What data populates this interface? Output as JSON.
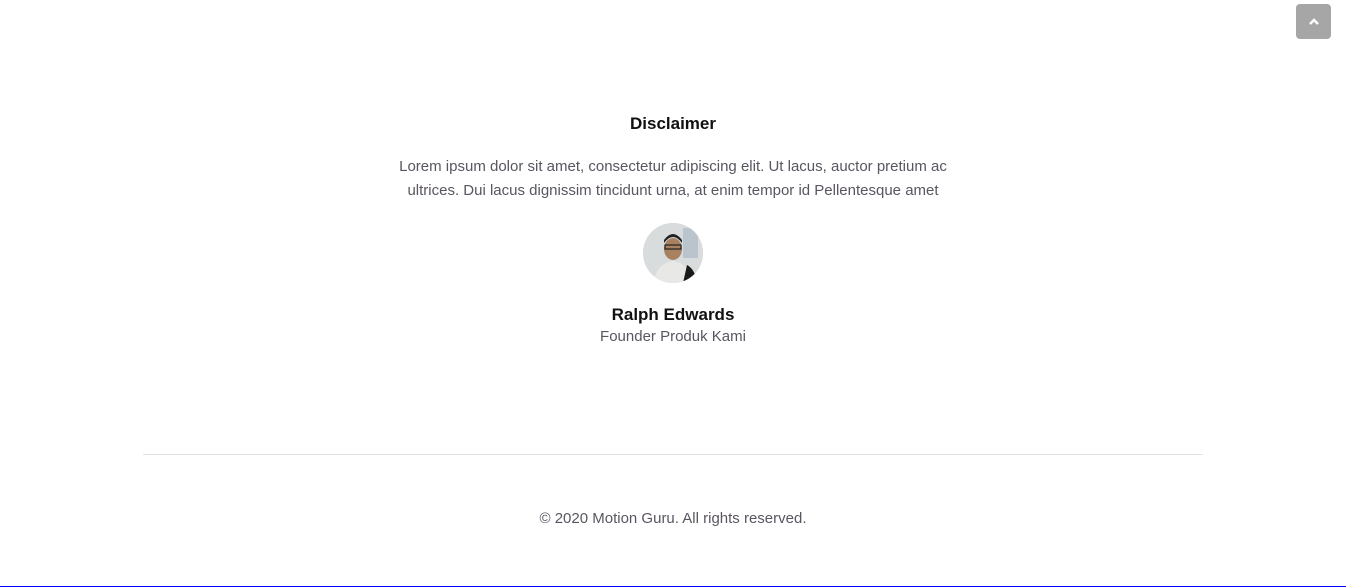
{
  "disclaimer": {
    "title": "Disclaimer",
    "text": "Lorem ipsum dolor sit amet, consectetur adipiscing elit. Ut lacus, auctor pretium ac ultrices. Dui lacus dignissim tincidunt urna, at enim tempor id Pellentesque amet"
  },
  "author": {
    "name": "Ralph Edwards",
    "role": "Founder Produk Kami"
  },
  "footer": {
    "copyright": "© 2020 Motion Guru. All rights reserved."
  },
  "scroll_top": {
    "icon": "chevron-up-icon"
  }
}
